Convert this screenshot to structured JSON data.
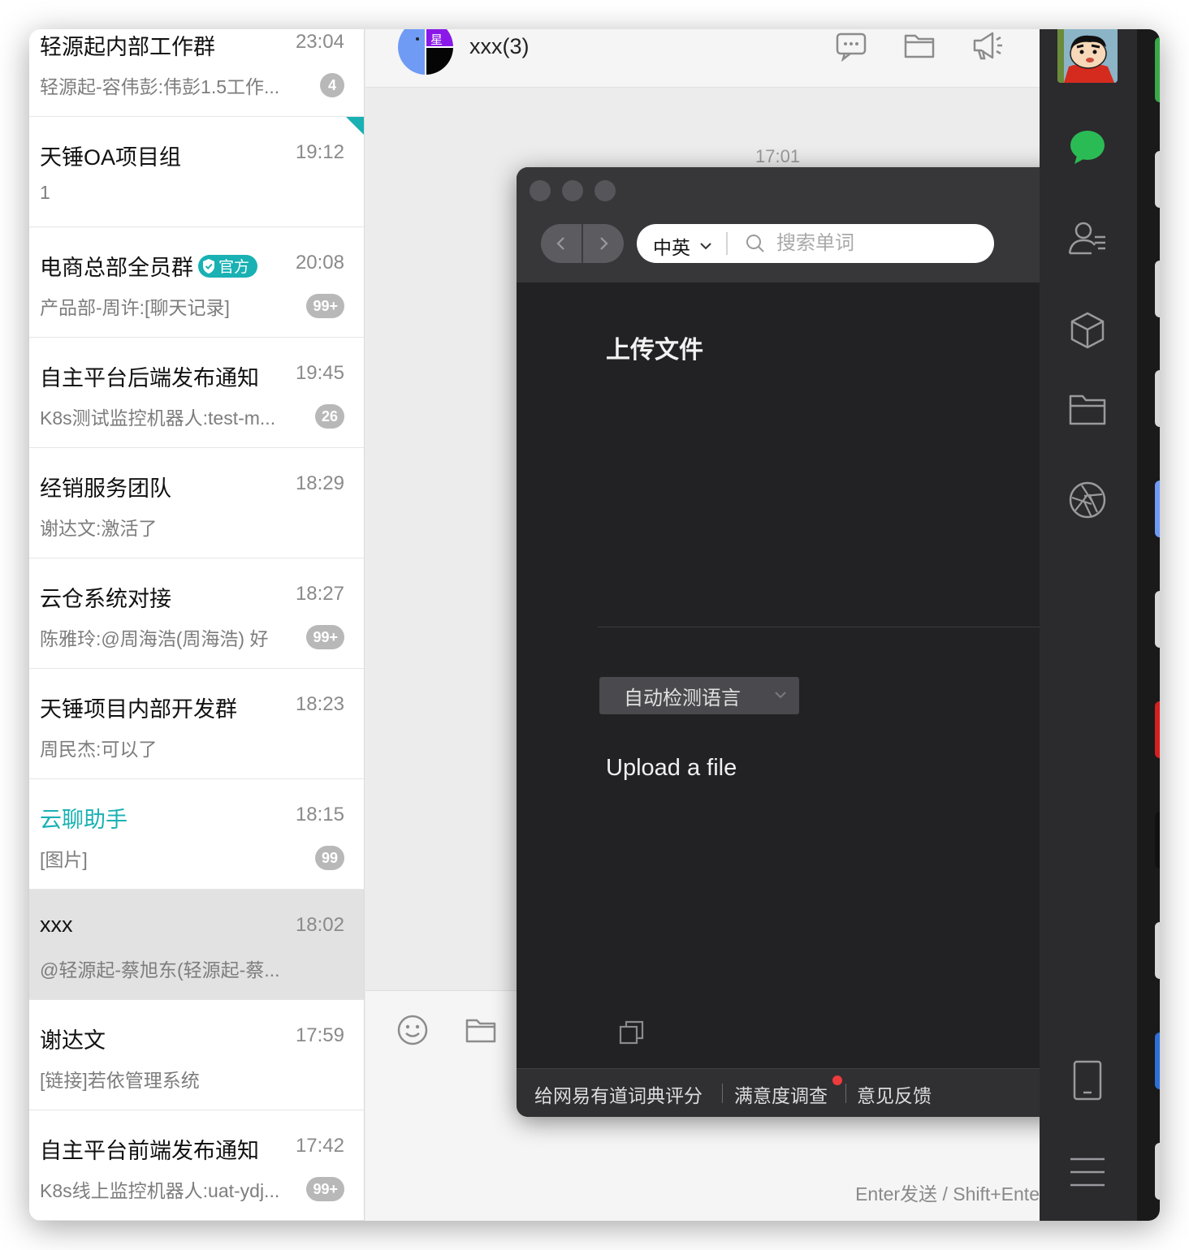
{
  "conversations": [
    {
      "name": "轻源起内部工作群",
      "time": "23:04",
      "preview": "轻源起-容伟彭:伟彭1.5工作...",
      "badge": "4"
    },
    {
      "name": "天锤OA项目组",
      "time": "19:12",
      "preview": "1",
      "badge": ""
    },
    {
      "name": "电商总部全员群",
      "official_label": "官方",
      "time": "20:08",
      "preview": "产品部-周许:[聊天记录]",
      "badge": "99+"
    },
    {
      "name": "自主平台后端发布通知",
      "time": "19:45",
      "preview": "K8s测试监控机器人:test-m...",
      "badge": "26"
    },
    {
      "name": "经销服务团队",
      "time": "18:29",
      "preview": "谢达文:激活了",
      "badge": ""
    },
    {
      "name": "云仓系统对接",
      "time": "18:27",
      "preview": "陈雅玲:@周海浩(周海浩) 好",
      "badge": "99+"
    },
    {
      "name": "天锤项目内部开发群",
      "time": "18:23",
      "preview": "周民杰:可以了",
      "badge": ""
    },
    {
      "name": "云聊助手",
      "time": "18:15",
      "preview": "[图片]",
      "badge": "99"
    },
    {
      "name": "xxx",
      "time": "18:02",
      "preview": "@轻源起-蔡旭东(轻源起-蔡...",
      "badge": ""
    },
    {
      "name": "谢达文",
      "time": "17:59",
      "preview": "[链接]若依管理系统",
      "badge": ""
    },
    {
      "name": "自主平台前端发布通知",
      "time": "17:42",
      "preview": "K8s线上监控机器人:uat-ydj...",
      "badge": "99+"
    }
  ],
  "chat": {
    "title": "xxx(3)",
    "avatar_glyph": "星",
    "timestamp": "17:01",
    "send_hint": "Enter发送 / Shift+Ente"
  },
  "dictionary": {
    "lang_pair": "中英",
    "search_placeholder": "搜索单词",
    "upload_title": "上传文件",
    "detect_language": "自动检测语言",
    "upload_en": "Upload a file",
    "footer": {
      "rate": "给网易有道词典评分",
      "survey": "满意度调查",
      "feedback": "意见反馈"
    }
  },
  "colors": {
    "accent": "#19b1b3",
    "chat_green": "#2bbb55",
    "badge_gray": "#b8b8b8",
    "dark_panel": "#222224",
    "notice_red": "#ee3b3b"
  },
  "icons": {
    "header": [
      "chat-record-icon",
      "folder-icon",
      "megaphone-icon"
    ],
    "input": [
      "emoji-icon",
      "folder-icon"
    ],
    "sidebar": [
      "chat-icon",
      "contacts-icon",
      "workbench-icon",
      "files-icon",
      "discover-icon",
      "phone-icon",
      "menu-icon"
    ]
  }
}
